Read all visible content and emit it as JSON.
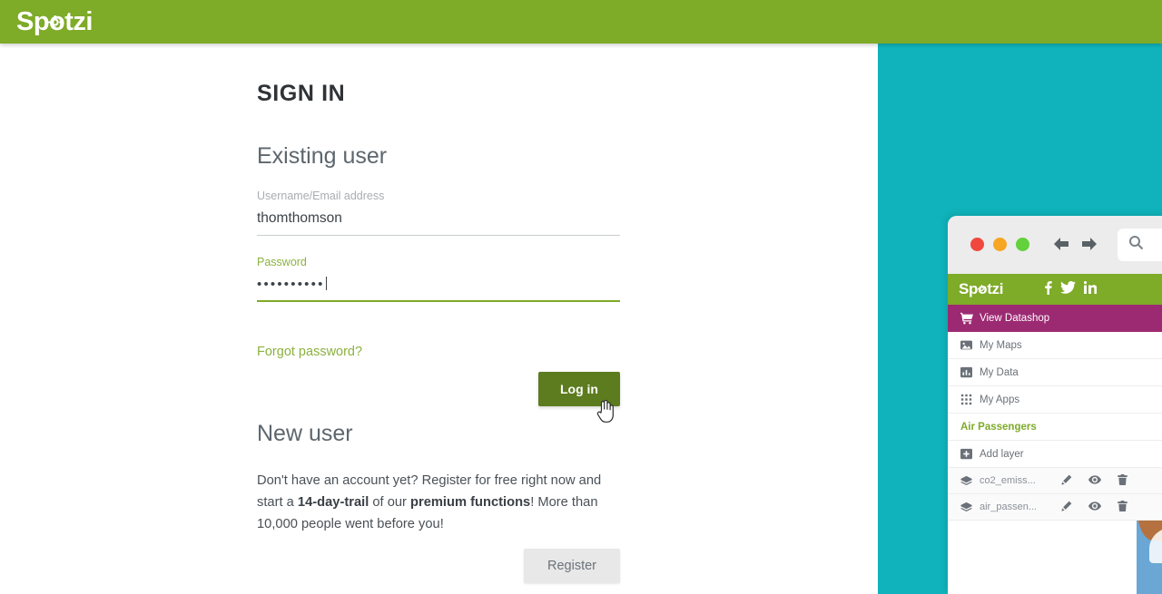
{
  "header": {
    "logo_text": "Spotzi",
    "logo_icon": "crosshair-target-icon",
    "background_color": "#7eab28"
  },
  "signin": {
    "page_title": "SIGN IN",
    "existing_user_heading": "Existing user",
    "username": {
      "label": "Username/Email address",
      "value": "thomthomson",
      "placeholder": ""
    },
    "password": {
      "label": "Password",
      "value": "••••••••••",
      "placeholder": ""
    },
    "forgot_password_link": "Forgot password?",
    "login_button": "Log in",
    "new_user_heading": "New user",
    "blurb": {
      "part1": "Don't have an account yet? Register for free right now and start a ",
      "bold1": "14-day-trail",
      "part2": " of our ",
      "bold2": "premium functions",
      "part3": "! More than 10,000 people went before you!"
    },
    "register_button": "Register"
  },
  "colors": {
    "brand_green": "#7eab28",
    "login_button_green": "#5c7c1f",
    "teal_panel": "#10b3bb",
    "magenta_active": "#9c2a72",
    "label_green": "#8cb13e"
  },
  "mockup": {
    "window_dots": [
      "red",
      "amber",
      "green"
    ],
    "nav_back_icon": "arrow-left-icon",
    "nav_forward_icon": "arrow-right-icon",
    "search_icon": "search-icon",
    "logo_text": "Spotzi",
    "socials": [
      "facebook-icon",
      "twitter-icon",
      "linkedin-icon"
    ],
    "menu": [
      {
        "label": "View Datashop",
        "icon": "shopping-cart-icon",
        "active": true
      },
      {
        "label": "My Maps",
        "icon": "maps-icon",
        "active": false
      },
      {
        "label": "My Data",
        "icon": "chart-bar-icon",
        "active": false
      },
      {
        "label": "My Apps",
        "icon": "grid-apps-icon",
        "active": false
      }
    ],
    "section_title": "Air Passengers",
    "add_layer": {
      "label": "Add layer",
      "icon": "plus-square-icon"
    },
    "layers": [
      {
        "name": "co2_emiss...",
        "icon": "layers-icon",
        "actions": [
          "pencil-icon",
          "eye-icon",
          "trash-icon"
        ]
      },
      {
        "name": "air_passen...",
        "icon": "layers-icon",
        "actions": [
          "pencil-icon",
          "eye-icon",
          "trash-icon"
        ]
      }
    ]
  }
}
